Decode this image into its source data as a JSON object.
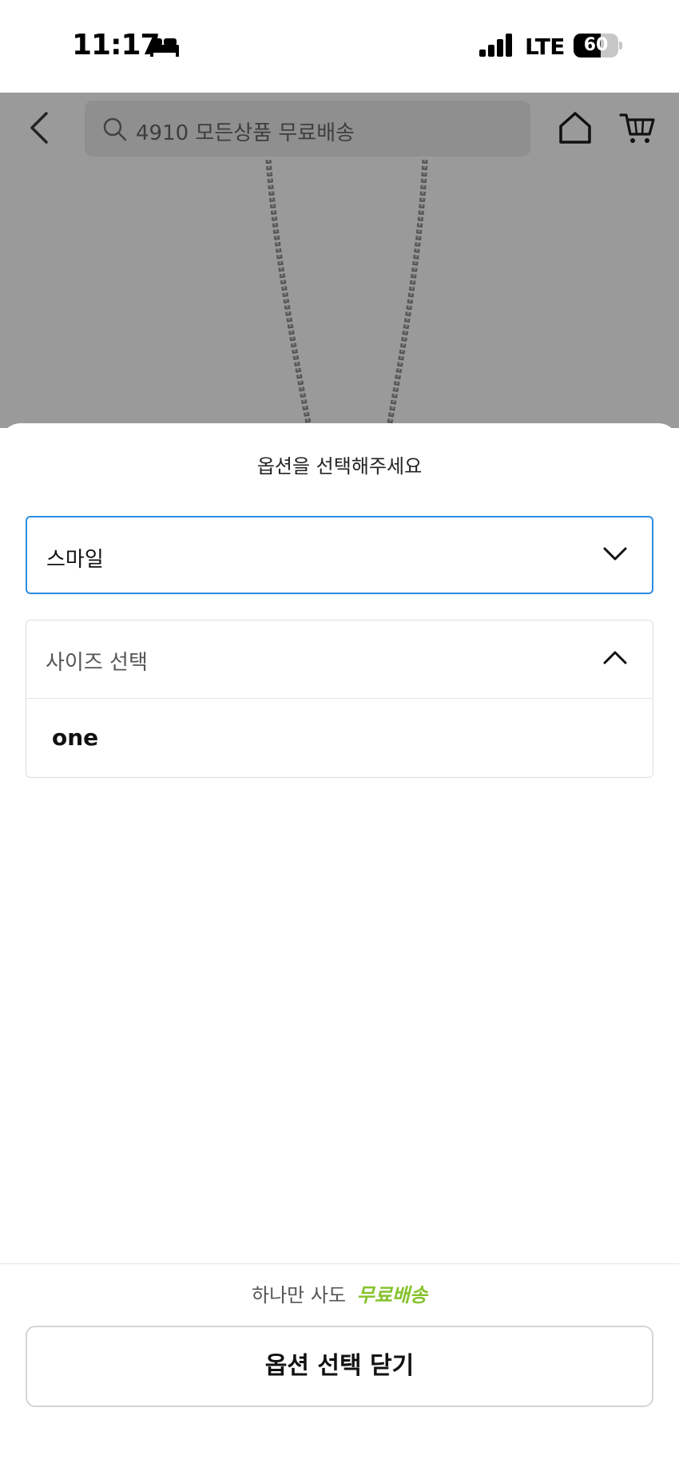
{
  "status_bar": {
    "time": "11:17",
    "network": "LTE",
    "battery_level": "60",
    "battery_fraction": 0.6
  },
  "header": {
    "search_text": "4910 모든상품 무료배송"
  },
  "sheet": {
    "title": "옵션을 선택해주세요",
    "option_select": {
      "value": "스마일"
    },
    "size_select": {
      "label": "사이즈 선택",
      "options": [
        "one"
      ]
    },
    "promo": {
      "prefix": "하나만 사도",
      "highlight": "무료배송"
    },
    "close_button_label": "옵션 선택 닫기"
  },
  "colors": {
    "accent_border": "#2d8ce3",
    "promo_green": "#86c22b",
    "dim_overlay": "#9a9a9a"
  }
}
